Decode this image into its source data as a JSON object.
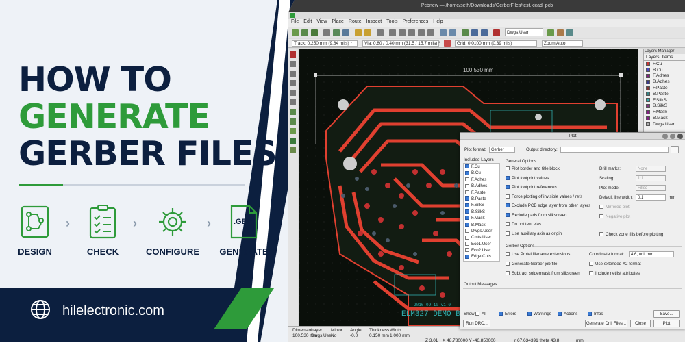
{
  "banner": {
    "title_line1": "HOW TO",
    "title_line2": "GENERATE",
    "title_line3": "GERBER FILES",
    "steps": [
      {
        "label": "DESIGN"
      },
      {
        "label": "CHECK"
      },
      {
        "label": "CONFIGURE"
      },
      {
        "label": "GENERATE",
        "file_label": ".GBR"
      }
    ],
    "website": "hilelectronic.com",
    "colors": {
      "navy": "#0c1f3f",
      "green": "#2e9b3a"
    }
  },
  "kicad": {
    "window_title": "Pcbnew — /home/seth/Downloads/GerberFiles/test.kicad_pcb",
    "menu": [
      "File",
      "Edit",
      "View",
      "Place",
      "Route",
      "Inspect",
      "Tools",
      "Preferences",
      "Help"
    ],
    "layer_combo": "Dwgs.User",
    "track": "Track: 0.250 mm (9.84 mils) *",
    "via": "Via: 0.80 / 0.40 mm (31.5 / 15.7 mils) *",
    "grid": "Grid: 0.0100 mm (0.39 mils)",
    "zoom": "Zoom Auto",
    "dimension_label": "100.530 mm",
    "board_text": "ELM327 DEMO BO",
    "board_text2": "2016-09-10 v1.0",
    "layers_manager": {
      "title": "Layers Manager",
      "tabs": [
        "Layers",
        "Items"
      ],
      "layers": [
        {
          "name": "F.Cu",
          "color": "#c83434"
        },
        {
          "name": "B.Cu",
          "color": "#4a4ac8"
        },
        {
          "name": "F.Adhes",
          "color": "#842084"
        },
        {
          "name": "B.Adhes",
          "color": "#3a3a8c"
        },
        {
          "name": "F.Paste",
          "color": "#843434"
        },
        {
          "name": "B.Paste",
          "color": "#3a8484"
        },
        {
          "name": "F.SilkS",
          "color": "#30b0b0"
        },
        {
          "name": "B.SilkS",
          "color": "#843484"
        },
        {
          "name": "F.Mask",
          "color": "#842084"
        },
        {
          "name": "B.Mask",
          "color": "#842084"
        },
        {
          "name": "Dwgs.User",
          "color": "#b0b0b0"
        }
      ]
    },
    "status": {
      "columns": [
        {
          "label": "Dimension",
          "value": "100.530 mm"
        },
        {
          "label": "Layer",
          "value": "Dwgs.User"
        },
        {
          "label": "Mirror",
          "value": "No"
        },
        {
          "label": "Angle",
          "value": "-0.0"
        },
        {
          "label": "Thickness",
          "value": "0.150 mm"
        },
        {
          "label": "Width",
          "value": "1.000 mm"
        }
      ],
      "z": "Z 3.01",
      "xy": "X 48.780000 Y -46.850000",
      "r": "r 67.634391 theta 43.8",
      "unit": "mm"
    },
    "plot_dialog": {
      "title": "Plot",
      "plot_format_label": "Plot format:",
      "plot_format": "Gerber",
      "output_dir_label": "Output directory:",
      "included_layers_label": "Included Layers",
      "included_layers": [
        {
          "name": "F.Cu",
          "checked": true
        },
        {
          "name": "B.Cu",
          "checked": true
        },
        {
          "name": "F.Adhes",
          "checked": false
        },
        {
          "name": "B.Adhes",
          "checked": false
        },
        {
          "name": "F.Paste",
          "checked": false
        },
        {
          "name": "B.Paste",
          "checked": true
        },
        {
          "name": "F.SilkS",
          "checked": true
        },
        {
          "name": "B.SilkS",
          "checked": true
        },
        {
          "name": "F.Mask",
          "checked": true
        },
        {
          "name": "B.Mask",
          "checked": true
        },
        {
          "name": "Dwgs.User",
          "checked": false
        },
        {
          "name": "Cmts.User",
          "checked": false
        },
        {
          "name": "Eco1.User",
          "checked": false
        },
        {
          "name": "Eco2.User",
          "checked": false
        },
        {
          "name": "Edge.Cuts",
          "checked": true
        }
      ],
      "general_options_label": "General Options",
      "general_options": [
        {
          "label": "Plot border and title block",
          "checked": false
        },
        {
          "label": "Plot footprint values",
          "checked": true
        },
        {
          "label": "Plot footprint references",
          "checked": true
        },
        {
          "label": "Force plotting of invisible values / refs",
          "checked": false
        },
        {
          "label": "Exclude PCB edge layer from other layers",
          "checked": true
        },
        {
          "label": "Exclude pads from silkscreen",
          "checked": true
        },
        {
          "label": "Do not tent vias",
          "checked": false
        },
        {
          "label": "Use auxiliary axis as origin",
          "checked": false
        }
      ],
      "drill_marks_label": "Drill marks:",
      "drill_marks": "None",
      "scaling_label": "Scaling:",
      "scaling": "1:1",
      "plot_mode_label": "Plot mode:",
      "plot_mode": "Filled",
      "default_line_width_label": "Default line width:",
      "default_line_width": "0.1",
      "line_width_unit": "mm",
      "mirrored_plot": "Mirrored plot",
      "negative_plot": "Negative plot",
      "check_zone_fills": "Check zone fills before plotting",
      "gerber_options_label": "Gerber Options",
      "gerber_options": [
        {
          "label": "Use Protel filename extensions",
          "checked": false
        },
        {
          "label": "Generate Gerber job file",
          "checked": false
        },
        {
          "label": "Subtract soldermask from silkscreen",
          "checked": false
        }
      ],
      "coordinate_format_label": "Coordinate format:",
      "coordinate_format": "4.6, unit mm",
      "use_extended_x2": "Use extended X2 format",
      "include_netlist": "Include netlist attributes",
      "output_messages_label": "Output Messages",
      "show_label": "Show:",
      "show_filters": [
        {
          "label": "All",
          "checked": false
        },
        {
          "label": "Errors",
          "checked": true
        },
        {
          "label": "Warnings",
          "checked": true
        },
        {
          "label": "Actions",
          "checked": true
        },
        {
          "label": "Infos",
          "checked": true
        }
      ],
      "save_button": "Save...",
      "run_drc_button": "Run DRC...",
      "generate_drill_button": "Generate Drill Files...",
      "close_button": "Close",
      "plot_button": "Plot"
    }
  }
}
